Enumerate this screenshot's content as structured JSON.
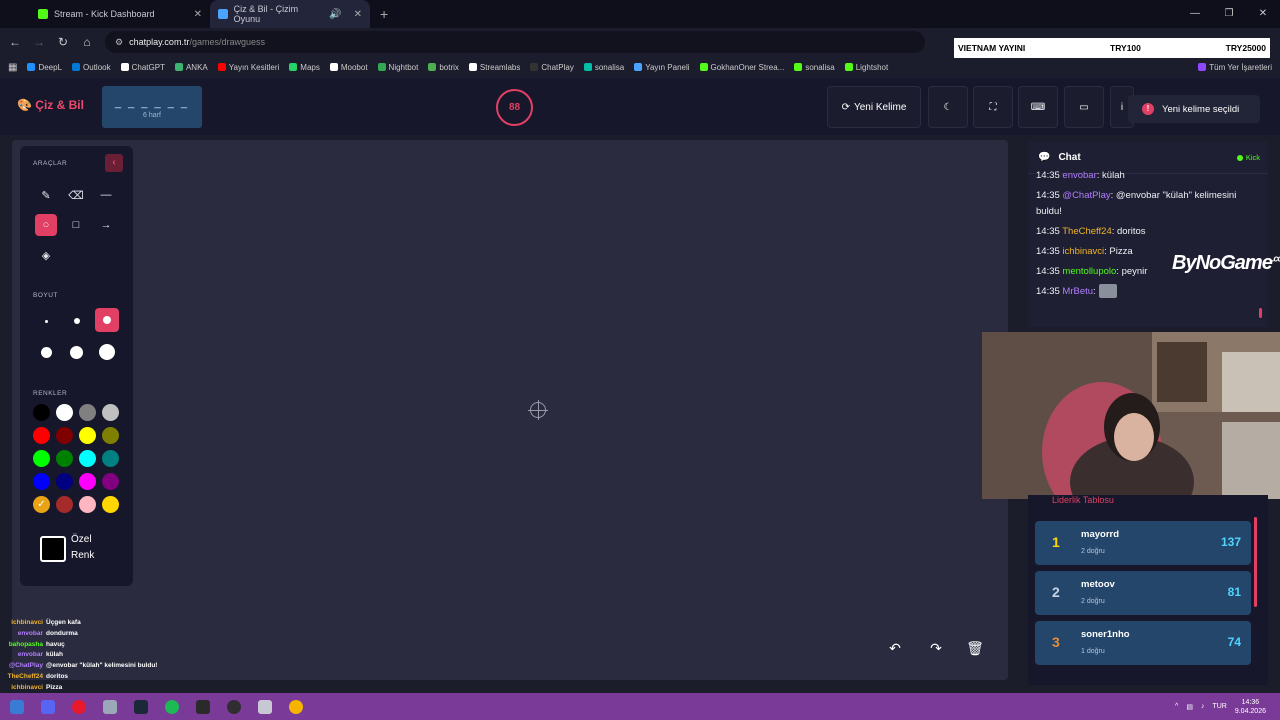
{
  "browser": {
    "tabs": [
      {
        "title": "Stream - Kick Dashboard",
        "favicon_color": "#53fc18"
      },
      {
        "title": "Çiz & Bil - Çizim Oyunu",
        "favicon_color": "#4aa3ff"
      }
    ],
    "new_tab": "+",
    "url_domain": "chatplay.com.tr",
    "url_path": "/games/drawguess",
    "bookmarks": [
      "DeepL",
      "Outlook",
      "ChatGPT",
      "ANKA",
      "Yayın Kesitleri",
      "Maps",
      "Moobot",
      "Nightbot",
      "botrix",
      "Streamlabs",
      "ChatPlay",
      "sonalisa",
      "Yayın Paneli",
      "GokhanOner Strea...",
      "sonalisa",
      "Lightshot",
      "Tüm Yer İşaretleri"
    ]
  },
  "overlay_banner": {
    "title": "VIETNAM YAYINI",
    "col1": "TRY100",
    "col2": "TRY25000"
  },
  "header": {
    "logo": "Çiz & Bil",
    "word_blanks": "_ _ _ _ _ _",
    "word_hint": "6 harf",
    "timer": "88",
    "new_word_button": "Yeni Kelime",
    "toast": "Yeni kelime seçildi",
    "toast_icon": "!"
  },
  "tools": {
    "section_tools": "ARAÇLAR",
    "section_size": "BOYUT",
    "section_colors": "RENKLER",
    "custom_color_line1": "Özel",
    "custom_color_line2": "Renk",
    "colors": [
      "#000000",
      "#ffffff",
      "#808080",
      "#c0c0c0",
      "#ff0000",
      "#800000",
      "#ffff00",
      "#808000",
      "#00ff00",
      "#008000",
      "#00ffff",
      "#008080",
      "#0000ff",
      "#000080",
      "#ff00ff",
      "#800080",
      "#e8a317",
      "#a52a2a",
      "#ffb6c1",
      "#ffd700"
    ]
  },
  "chat": {
    "title": "Chat",
    "platform": "Kick",
    "messages": [
      {
        "time": "14:35",
        "user": "envobar",
        "color": "#b37dff",
        "text": ": külah"
      },
      {
        "time": "14:35",
        "user": "@ChatPlay",
        "color": "#b37dff",
        "text": ": @envobar \"külah\" kelimesini buldu!"
      },
      {
        "time": "14:35",
        "user": "TheCheff24",
        "color": "#f0b429",
        "text": ": doritos"
      },
      {
        "time": "14:35",
        "user": "ichbinavci",
        "color": "#f0b429",
        "text": ": Pizza"
      },
      {
        "time": "14:35",
        "user": "mentollupolo",
        "color": "#53fc18",
        "text": ": peynir"
      },
      {
        "time": "14:35",
        "user": "MrBetu",
        "color": "#b37dff",
        "text": ":"
      }
    ],
    "sponsor": "ByNoGame",
    "sponsor_sup": ".com"
  },
  "leaderboard": {
    "title": "Liderlik Tablosu",
    "rows": [
      {
        "rank": "1",
        "name": "mayorrd",
        "sub": "2 doğru",
        "score": "137",
        "rank_color": "#ffd700"
      },
      {
        "rank": "2",
        "name": "metoov",
        "sub": "2 doğru",
        "score": "81",
        "rank_color": "#c8d4e6"
      },
      {
        "rank": "3",
        "name": "soner1nho",
        "sub": "1 doğru",
        "score": "74",
        "rank_color": "#e58b3a"
      }
    ]
  },
  "overlay_chat": [
    {
      "user": "ichbinavci",
      "color": "#f0b429",
      "text": "Üçgen kafa"
    },
    {
      "user": "envobar",
      "color": "#b37dff",
      "text": "dondurma"
    },
    {
      "user": "bahopasha",
      "color": "#53fc18",
      "text": "havuç"
    },
    {
      "user": "envobar",
      "color": "#b37dff",
      "text": "külah"
    },
    {
      "user": "@ChatPlay",
      "color": "#b37dff",
      "text": "@envobar \"külah\" kelimesini buldu!"
    },
    {
      "user": "TheCheff24",
      "color": "#f0b429",
      "text": "doritos"
    },
    {
      "user": "ichbinavci",
      "color": "#f0b429",
      "text": "Pizza"
    },
    {
      "user": "mentollupolo",
      "color": "#53fc18",
      "text": "peynir"
    }
  ],
  "taskbar": {
    "lang": "TUR",
    "time": "14:36",
    "date": "9.04.2026"
  },
  "accent": "#e23f65"
}
